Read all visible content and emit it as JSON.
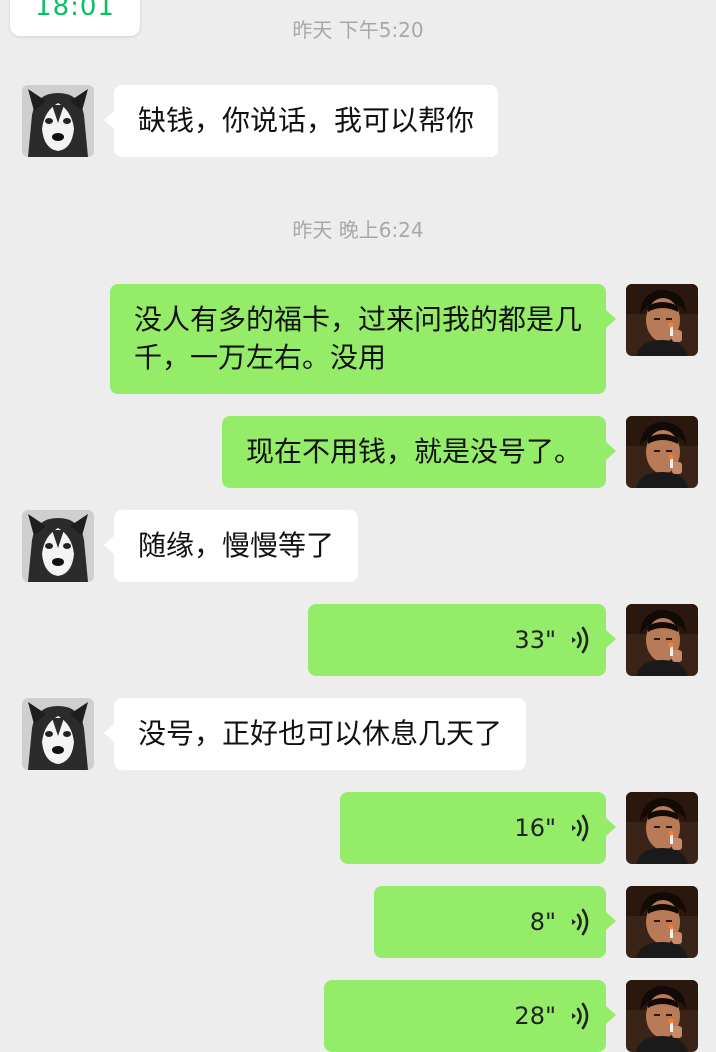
{
  "top_card": {
    "text": "18:01"
  },
  "timestamps": [
    "昨天 下午5:20",
    "昨天 晚上6:24"
  ],
  "messages": [
    {
      "side": "left",
      "type": "text",
      "text": "缺钱，你说话，我可以帮你"
    },
    {
      "side": "right",
      "type": "text",
      "text": "没人有多的福卡，过来问我的都是几千，一万左右。没用"
    },
    {
      "side": "right",
      "type": "text",
      "text": "现在不用钱，就是没号了。"
    },
    {
      "side": "left",
      "type": "text",
      "text": "随缘，慢慢等了"
    },
    {
      "side": "right",
      "type": "voice",
      "duration": "33\""
    },
    {
      "side": "left",
      "type": "text",
      "text": "没号，正好也可以休息几天了"
    },
    {
      "side": "right",
      "type": "voice",
      "duration": "16\""
    },
    {
      "side": "right",
      "type": "voice",
      "duration": "8\""
    },
    {
      "side": "right",
      "type": "voice",
      "duration": "28\""
    }
  ],
  "icons": {
    "left_avatar": "husky-dog-avatar",
    "right_avatar": "man-portrait-avatar",
    "voice": "voice-wave-icon"
  },
  "colors": {
    "background": "#ededed",
    "sent_bubble": "#95ec69",
    "received_bubble": "#ffffff",
    "accent": "#07c160"
  }
}
